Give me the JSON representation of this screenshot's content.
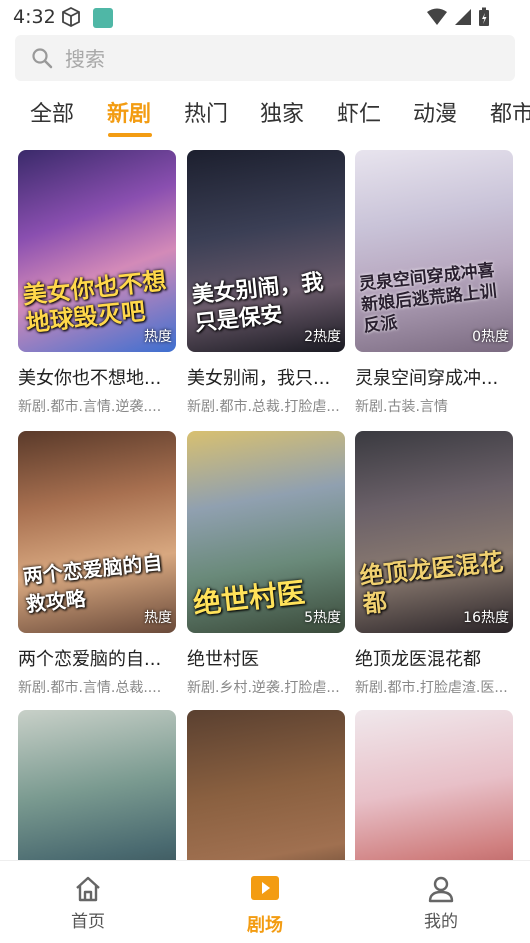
{
  "status_bar": {
    "time": "4:32"
  },
  "search": {
    "placeholder": "搜索"
  },
  "tabs": [
    "全部",
    "新剧",
    "热门",
    "独家",
    "虾仁",
    "动漫",
    "都市"
  ],
  "active_tab_index": 1,
  "cards": [
    {
      "poster_text": "美女你也不想地球毁灭吧",
      "heat": "热度",
      "title": "美女你也不想地...",
      "tags": "新剧.都市.言情.逆袭...."
    },
    {
      "poster_text": "美女别闹，我只是保安",
      "heat": "2热度",
      "title": "美女别闹，我只...",
      "tags": "新剧.都市.总裁.打脸虐..."
    },
    {
      "poster_text": "灵泉空间穿成冲喜新娘后逃荒路上训反派",
      "heat": "0热度",
      "title": "灵泉空间穿成冲...",
      "tags": "新剧.古装.言情"
    },
    {
      "poster_text": "两个恋爱脑的自救攻略",
      "heat": "热度",
      "title": "两个恋爱脑的自...",
      "tags": "新剧.都市.言情.总裁...."
    },
    {
      "poster_text": "绝世村医",
      "heat": "5热度",
      "title": "绝世村医",
      "tags": "新剧.乡村.逆袭.打脸虐..."
    },
    {
      "poster_text": "绝顶龙医混花都",
      "heat": "16热度",
      "title": "绝顶龙医混花都",
      "tags": "新剧.都市.打脸虐渣.医..."
    },
    {
      "poster_text": "",
      "heat": "",
      "title": "",
      "tags": ""
    },
    {
      "poster_text": "",
      "heat": "",
      "title": "",
      "tags": ""
    },
    {
      "poster_text": "",
      "heat": "",
      "title": "",
      "tags": ""
    }
  ],
  "bottom_nav": [
    {
      "label": "首页",
      "icon": "home-icon"
    },
    {
      "label": "剧场",
      "icon": "play-icon"
    },
    {
      "label": "我的",
      "icon": "person-icon"
    }
  ],
  "active_nav_index": 1,
  "colors": {
    "accent": "#f39c12"
  }
}
